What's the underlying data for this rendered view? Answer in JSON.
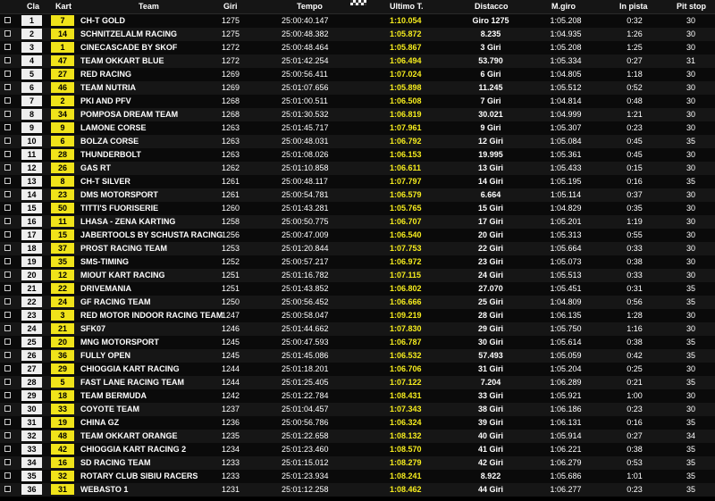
{
  "headers": {
    "pos": "Cla",
    "kart": "Kart",
    "team": "Team",
    "laps": "Giri",
    "time": "Tempo",
    "last": "Ultimo T.",
    "gap": "Distacco",
    "best": "M.giro",
    "in_pit": "In pista",
    "stops": "Pit stop"
  },
  "rows": [
    {
      "pos": "1",
      "kart": "7",
      "team": "CH-T GOLD",
      "laps": "1275",
      "time": "25:00:40.147",
      "last": "1:10.054",
      "gap": "Giro 1275",
      "best": "1:05.208",
      "in_pit": "0:32",
      "stops": "30"
    },
    {
      "pos": "2",
      "kart": "14",
      "team": "SCHNITZELALM RACING",
      "laps": "1275",
      "time": "25:00:48.382",
      "last": "1:05.872",
      "gap": "8.235",
      "best": "1:04.935",
      "in_pit": "1:26",
      "stops": "30"
    },
    {
      "pos": "3",
      "kart": "1",
      "team": "CINECASCADE BY SKOF",
      "laps": "1272",
      "time": "25:00:48.464",
      "last": "1:05.867",
      "gap": "3 Giri",
      "best": "1:05.208",
      "in_pit": "1:25",
      "stops": "30"
    },
    {
      "pos": "4",
      "kart": "47",
      "team": "TEAM OKKART BLUE",
      "laps": "1272",
      "time": "25:01:42.254",
      "last": "1:06.494",
      "gap": "53.790",
      "best": "1:05.334",
      "in_pit": "0:27",
      "stops": "31"
    },
    {
      "pos": "5",
      "kart": "27",
      "team": "RED RACING",
      "laps": "1269",
      "time": "25:00:56.411",
      "last": "1:07.024",
      "gap": "6 Giri",
      "best": "1:04.805",
      "in_pit": "1:18",
      "stops": "30"
    },
    {
      "pos": "6",
      "kart": "46",
      "team": "TEAM NUTRIA",
      "laps": "1269",
      "time": "25:01:07.656",
      "last": "1:05.898",
      "gap": "11.245",
      "best": "1:05.512",
      "in_pit": "0:52",
      "stops": "30"
    },
    {
      "pos": "7",
      "kart": "2",
      "team": "PKI AND PFV",
      "laps": "1268",
      "time": "25:01:00.511",
      "last": "1:06.508",
      "gap": "7 Giri",
      "best": "1:04.814",
      "in_pit": "0:48",
      "stops": "30"
    },
    {
      "pos": "8",
      "kart": "34",
      "team": "POMPOSA DREAM TEAM",
      "laps": "1268",
      "time": "25:01:30.532",
      "last": "1:06.819",
      "gap": "30.021",
      "best": "1:04.999",
      "in_pit": "1:21",
      "stops": "30"
    },
    {
      "pos": "9",
      "kart": "9",
      "team": "LAMONE CORSE",
      "laps": "1263",
      "time": "25:01:45.717",
      "last": "1:07.961",
      "gap": "9 Giri",
      "best": "1:05.307",
      "in_pit": "0:23",
      "stops": "30"
    },
    {
      "pos": "10",
      "kart": "6",
      "team": "BOLZA CORSE",
      "laps": "1263",
      "time": "25:00:48.031",
      "last": "1:06.792",
      "gap": "12 Giri",
      "best": "1:05.084",
      "in_pit": "0:45",
      "stops": "35"
    },
    {
      "pos": "11",
      "kart": "28",
      "team": "THUNDERBOLT",
      "laps": "1263",
      "time": "25:01:08.026",
      "last": "1:06.153",
      "gap": "19.995",
      "best": "1:05.361",
      "in_pit": "0:45",
      "stops": "30"
    },
    {
      "pos": "12",
      "kart": "26",
      "team": "GAS RT",
      "laps": "1262",
      "time": "25:01:10.858",
      "last": "1:06.611",
      "gap": "13 Giri",
      "best": "1:05.433",
      "in_pit": "0:15",
      "stops": "30"
    },
    {
      "pos": "13",
      "kart": "8",
      "team": "CH-T SILVER",
      "laps": "1261",
      "time": "25:00:48.117",
      "last": "1:07.797",
      "gap": "14 Giri",
      "best": "1:05.195",
      "in_pit": "0:16",
      "stops": "35"
    },
    {
      "pos": "14",
      "kart": "23",
      "team": "DMS MOTORSPORT",
      "laps": "1261",
      "time": "25:00:54.781",
      "last": "1:06.579",
      "gap": "6.664",
      "best": "1:05.114",
      "in_pit": "0:37",
      "stops": "30"
    },
    {
      "pos": "15",
      "kart": "50",
      "team": "TITTI'S FUORISERIE",
      "laps": "1260",
      "time": "25:01:43.281",
      "last": "1:05.765",
      "gap": "15 Giri",
      "best": "1:04.829",
      "in_pit": "0:35",
      "stops": "30"
    },
    {
      "pos": "16",
      "kart": "11",
      "team": "LHASA - ZENA KARTING",
      "laps": "1258",
      "time": "25:00:50.775",
      "last": "1:06.707",
      "gap": "17 Giri",
      "best": "1:05.201",
      "in_pit": "1:19",
      "stops": "30"
    },
    {
      "pos": "17",
      "kart": "15",
      "team": "JABERTOOLS BY SCHUSTA RACING",
      "laps": "1256",
      "time": "25:00:47.009",
      "last": "1:06.540",
      "gap": "20 Giri",
      "best": "1:05.313",
      "in_pit": "0:55",
      "stops": "30"
    },
    {
      "pos": "18",
      "kart": "37",
      "team": "PROST RACING TEAM",
      "laps": "1253",
      "time": "25:01:20.844",
      "last": "1:07.753",
      "gap": "22 Giri",
      "best": "1:05.664",
      "in_pit": "0:33",
      "stops": "30"
    },
    {
      "pos": "19",
      "kart": "35",
      "team": "SMS-TIMING",
      "laps": "1252",
      "time": "25:00:57.217",
      "last": "1:06.972",
      "gap": "23 Giri",
      "best": "1:05.073",
      "in_pit": "0:38",
      "stops": "30"
    },
    {
      "pos": "20",
      "kart": "12",
      "team": "MIOUT KART RACING",
      "laps": "1251",
      "time": "25:01:16.782",
      "last": "1:07.115",
      "gap": "24 Giri",
      "best": "1:05.513",
      "in_pit": "0:33",
      "stops": "30"
    },
    {
      "pos": "21",
      "kart": "22",
      "team": "DRIVEMANIA",
      "laps": "1251",
      "time": "25:01:43.852",
      "last": "1:06.802",
      "gap": "27.070",
      "best": "1:05.451",
      "in_pit": "0:31",
      "stops": "35"
    },
    {
      "pos": "22",
      "kart": "24",
      "team": "GF RACING TEAM",
      "laps": "1250",
      "time": "25:00:56.452",
      "last": "1:06.666",
      "gap": "25 Giri",
      "best": "1:04.809",
      "in_pit": "0:56",
      "stops": "35"
    },
    {
      "pos": "23",
      "kart": "3",
      "team": "RED MOTOR INDOOR RACING TEAM",
      "laps": "1247",
      "time": "25:00:58.047",
      "last": "1:09.219",
      "gap": "28 Giri",
      "best": "1:06.135",
      "in_pit": "1:28",
      "stops": "30"
    },
    {
      "pos": "24",
      "kart": "21",
      "team": "SFK07",
      "laps": "1246",
      "time": "25:01:44.662",
      "last": "1:07.830",
      "gap": "29 Giri",
      "best": "1:05.750",
      "in_pit": "1:16",
      "stops": "30"
    },
    {
      "pos": "25",
      "kart": "20",
      "team": "MNG MOTORSPORT",
      "laps": "1245",
      "time": "25:00:47.593",
      "last": "1:06.787",
      "gap": "30 Giri",
      "best": "1:05.614",
      "in_pit": "0:38",
      "stops": "35"
    },
    {
      "pos": "26",
      "kart": "36",
      "team": "FULLY OPEN",
      "laps": "1245",
      "time": "25:01:45.086",
      "last": "1:06.532",
      "gap": "57.493",
      "best": "1:05.059",
      "in_pit": "0:42",
      "stops": "35"
    },
    {
      "pos": "27",
      "kart": "29",
      "team": "CHIOGGIA KART RACING",
      "laps": "1244",
      "time": "25:01:18.201",
      "last": "1:06.706",
      "gap": "31 Giri",
      "best": "1:05.204",
      "in_pit": "0:25",
      "stops": "30"
    },
    {
      "pos": "28",
      "kart": "5",
      "team": "FAST LANE RACING TEAM",
      "laps": "1244",
      "time": "25:01:25.405",
      "last": "1:07.122",
      "gap": "7.204",
      "best": "1:06.289",
      "in_pit": "0:21",
      "stops": "35"
    },
    {
      "pos": "29",
      "kart": "18",
      "team": "TEAM BERMUDA",
      "laps": "1242",
      "time": "25:01:22.784",
      "last": "1:08.431",
      "gap": "33 Giri",
      "best": "1:05.921",
      "in_pit": "1:00",
      "stops": "30"
    },
    {
      "pos": "30",
      "kart": "33",
      "team": "COYOTE TEAM",
      "laps": "1237",
      "time": "25:01:04.457",
      "last": "1:07.343",
      "gap": "38 Giri",
      "best": "1:06.186",
      "in_pit": "0:23",
      "stops": "30"
    },
    {
      "pos": "31",
      "kart": "19",
      "team": "CHINA GZ",
      "laps": "1236",
      "time": "25:00:56.786",
      "last": "1:06.324",
      "gap": "39 Giri",
      "best": "1:06.131",
      "in_pit": "0:16",
      "stops": "35"
    },
    {
      "pos": "32",
      "kart": "48",
      "team": "TEAM OKKART ORANGE",
      "laps": "1235",
      "time": "25:01:22.658",
      "last": "1:08.132",
      "gap": "40 Giri",
      "best": "1:05.914",
      "in_pit": "0:27",
      "stops": "34"
    },
    {
      "pos": "33",
      "kart": "42",
      "team": "CHIOGGIA KART RACING 2",
      "laps": "1234",
      "time": "25:01:23.460",
      "last": "1:08.570",
      "gap": "41 Giri",
      "best": "1:06.221",
      "in_pit": "0:38",
      "stops": "35"
    },
    {
      "pos": "34",
      "kart": "16",
      "team": "SD RACING TEAM",
      "laps": "1233",
      "time": "25:01:15.012",
      "last": "1:08.279",
      "gap": "42 Giri",
      "best": "1:06.279",
      "in_pit": "0:53",
      "stops": "35"
    },
    {
      "pos": "35",
      "kart": "32",
      "team": "ROTARY CLUB SIBIU RACERS",
      "laps": "1233",
      "time": "25:01:23.934",
      "last": "1:08.241",
      "gap": "8.922",
      "best": "1:05.686",
      "in_pit": "1:01",
      "stops": "35"
    },
    {
      "pos": "36",
      "kart": "31",
      "team": "WEBASTO 1",
      "laps": "1231",
      "time": "25:01:12.258",
      "last": "1:08.462",
      "gap": "44 Giri",
      "best": "1:06.277",
      "in_pit": "0:23",
      "stops": "35"
    }
  ]
}
